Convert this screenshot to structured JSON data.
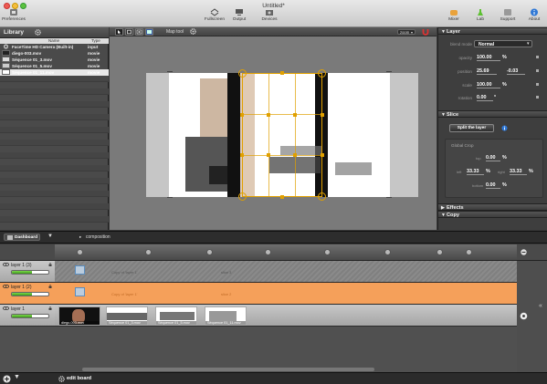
{
  "window": {
    "title": "Untitled*"
  },
  "toolbar": {
    "preferences": "Preferences",
    "fullscreen": "Fullscreen",
    "output": "Output",
    "devices": "Devices",
    "mixer": "Mixer",
    "lab": "Lab",
    "support": "Support",
    "about": "About"
  },
  "library": {
    "title": "Library",
    "col_name": "Name",
    "col_type": "Type",
    "items": [
      {
        "name": "FaceTime HD Camera (Built-in)",
        "type": "input"
      },
      {
        "name": "diego-003.mov",
        "type": "movie"
      },
      {
        "name": "Séquence 01_3.mov",
        "type": "movie"
      },
      {
        "name": "Séquence 01_5.mov",
        "type": "movie"
      },
      {
        "name": "Séquence 01_11.mov",
        "type": "movie"
      }
    ]
  },
  "viewer": {
    "map_tool": "Map tool",
    "zoom": "zoom"
  },
  "inspector": {
    "layer_title": "Layer",
    "blend_mode_label": "blend mode",
    "blend_mode_value": "Normal",
    "opacity_label": "opacity",
    "opacity_value": "100.00",
    "opacity_unit": "%",
    "position_label": "position",
    "position_x": "25.69",
    "position_y": "-0.03",
    "scale_label": "scale",
    "scale_value": "100.00",
    "scale_unit": "%",
    "rotation_label": "rotation",
    "rotation_value": "0.00",
    "rotation_unit": "°",
    "slice_title": "Slice",
    "split_button": "Split the layer",
    "global_crop_label": "Global Crop",
    "crop_top_label": "top",
    "crop_top_value": "0.00",
    "crop_left_label": "left",
    "crop_left_value": "33.33",
    "crop_right_label": "right",
    "crop_right_value": "33.33",
    "crop_bottom_label": "bottom",
    "crop_bottom_value": "0.00",
    "crop_unit": "%",
    "effects_title": "Effects",
    "copy_title": "Copy"
  },
  "dashboard": {
    "label": "Dashboard",
    "composition": "composition"
  },
  "timeline": {
    "tracks": [
      {
        "title": "layer 1 (3)",
        "clip_a": "Copy of 'layer 1'",
        "clip_b": "slice 3",
        "opacity": 0.55
      },
      {
        "title": "layer 1 (2)",
        "clip_a": "Copy of 'layer 1'",
        "clip_b": "slice 2",
        "opacity": 0.55
      },
      {
        "title": "layer 1",
        "opacity": 0.55
      }
    ],
    "thumbs": [
      "diego-003.mov",
      "Séquence 01_3.mov",
      "Séquence 01_5.mov",
      "Séquence 01_11.mov"
    ]
  },
  "bottom": {
    "edit_board": "edit board"
  },
  "colors": {
    "accent": "#f5a05a",
    "selection_handle": "#e0a000",
    "opacity_green": "#5cc030",
    "selected_row": "#e7e7e7"
  }
}
